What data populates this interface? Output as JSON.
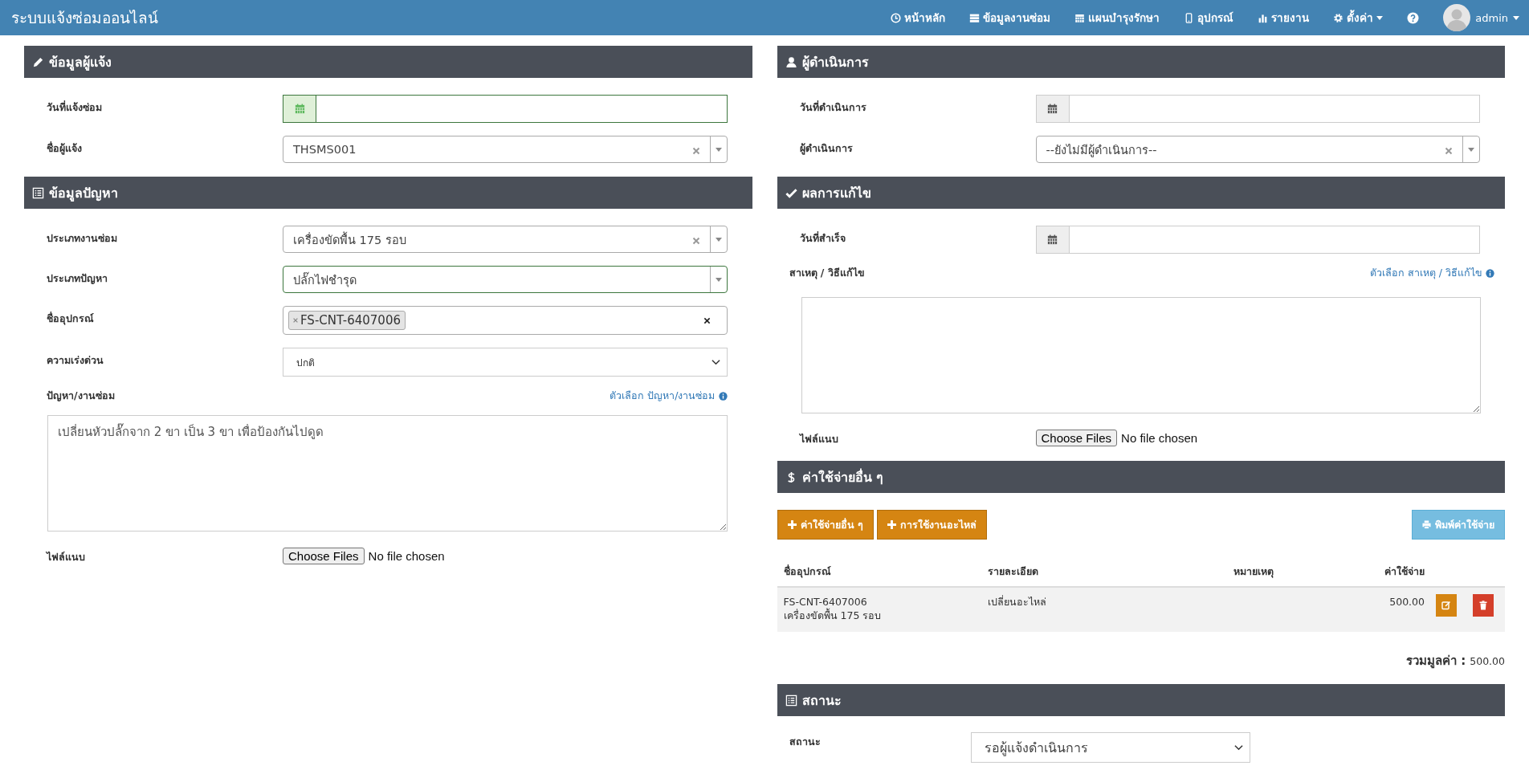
{
  "app_title": "ระบบแจ้งซ่อมออนไลน์",
  "nav": [
    {
      "label": "หน้าหลัก",
      "dropdown": false
    },
    {
      "label": "ข้อมูลงานซ่อม",
      "dropdown": false
    },
    {
      "label": "แผนบำรุงรักษา",
      "dropdown": false
    },
    {
      "label": "อุปกรณ์",
      "dropdown": false
    },
    {
      "label": "รายงาน",
      "dropdown": false
    },
    {
      "label": "ตั้งค่า",
      "dropdown": true
    }
  ],
  "user": {
    "name": "admin"
  },
  "left": [
    {
      "title": "ข้อมูลผู้แจ้ง",
      "fields": [
        {
          "kind": "date",
          "label": "วันที่แจ้งซ่อม",
          "valid": true
        },
        {
          "kind": "combo",
          "label": "ชื่อผู้แจ้ง",
          "value": "THSMS001",
          "clearable": true,
          "valid": false
        }
      ]
    },
    {
      "title": "ข้อมูลปัญหา",
      "fields": [
        {
          "kind": "combo",
          "label": "ประเภทงานซ่อม",
          "value": "เครื่องขัดพื้น 175 รอบ",
          "clearable": true,
          "valid": false
        },
        {
          "kind": "combo",
          "label": "ประเภทปัญหา",
          "value": "ปลั๊กไฟชำรุด",
          "clearable": false,
          "valid": true
        },
        {
          "kind": "tags",
          "label": "ชื่ออุปกรณ์",
          "tags": [
            "FS-CNT-6407006"
          ]
        },
        {
          "kind": "select",
          "label": "ความเร่งด่วน",
          "value": "ปกติ"
        },
        {
          "kind": "textarea",
          "label": "ปัญหา/งานซ่อม",
          "link": "ตัวเลือก ปัญหา/งานซ่อม",
          "value": "เปลี่ยนหัวปลั๊กจาก 2 ขา เป็น 3 ขา เพื่อป้องกันไปดูด"
        },
        {
          "kind": "file",
          "label": "ไฟล์แนบ",
          "button": "Choose Files",
          "status": "No file chosen"
        }
      ]
    }
  ],
  "right": [
    {
      "title": "ผู้ดำเนินการ",
      "fields": [
        {
          "kind": "date",
          "label": "วันที่ดำเนินการ",
          "valid": false
        },
        {
          "kind": "combo",
          "label": "ผู้ดำเนินการ",
          "value": "--ยังไม่มีผู้ดำเนินการ--",
          "clearable": true,
          "valid": false
        }
      ]
    },
    {
      "title": "ผลการแก้ไข",
      "fields": [
        {
          "kind": "date",
          "label": "วันที่สำเร็จ",
          "valid": false
        },
        {
          "kind": "textarea",
          "label": "สาเหตุ / วิธีแก้ไข",
          "link": "ตัวเลือก สาเหตุ / วิธีแก้ไข"
        },
        {
          "kind": "file",
          "label": "ไฟล์แนบ",
          "button": "Choose Files",
          "status": "No file chosen"
        }
      ]
    },
    {
      "title": "ค่าใช้จ่ายอื่น ๆ",
      "fields": [
        {
          "kind": "expenses",
          "buttons": [
            "ค่าใช้จ่ายอื่น ๆ",
            "การใช้งานอะไหล่"
          ],
          "print_button": "พิมพ์ค่าใช้จ่าย",
          "columns": [
            "ชื่ออุปกรณ์",
            "รายละเอียด",
            "หมายเหตุ",
            "ค่าใช้จ่าย"
          ],
          "rows": [
            {
              "device": "FS-CNT-6407006",
              "device_type": "เครื่องขัดพื้น 175 รอบ",
              "detail": "เปลี่ยนอะไหล่",
              "cost": "500.00"
            }
          ],
          "total_label": "รวมมูลค่า :",
          "total_value": "500.00"
        }
      ]
    },
    {
      "title": "สถานะ",
      "fields": [
        {
          "kind": "status",
          "label": "สถานะ",
          "value": "รอผู้แจ้งดำเนินการ"
        }
      ]
    }
  ]
}
